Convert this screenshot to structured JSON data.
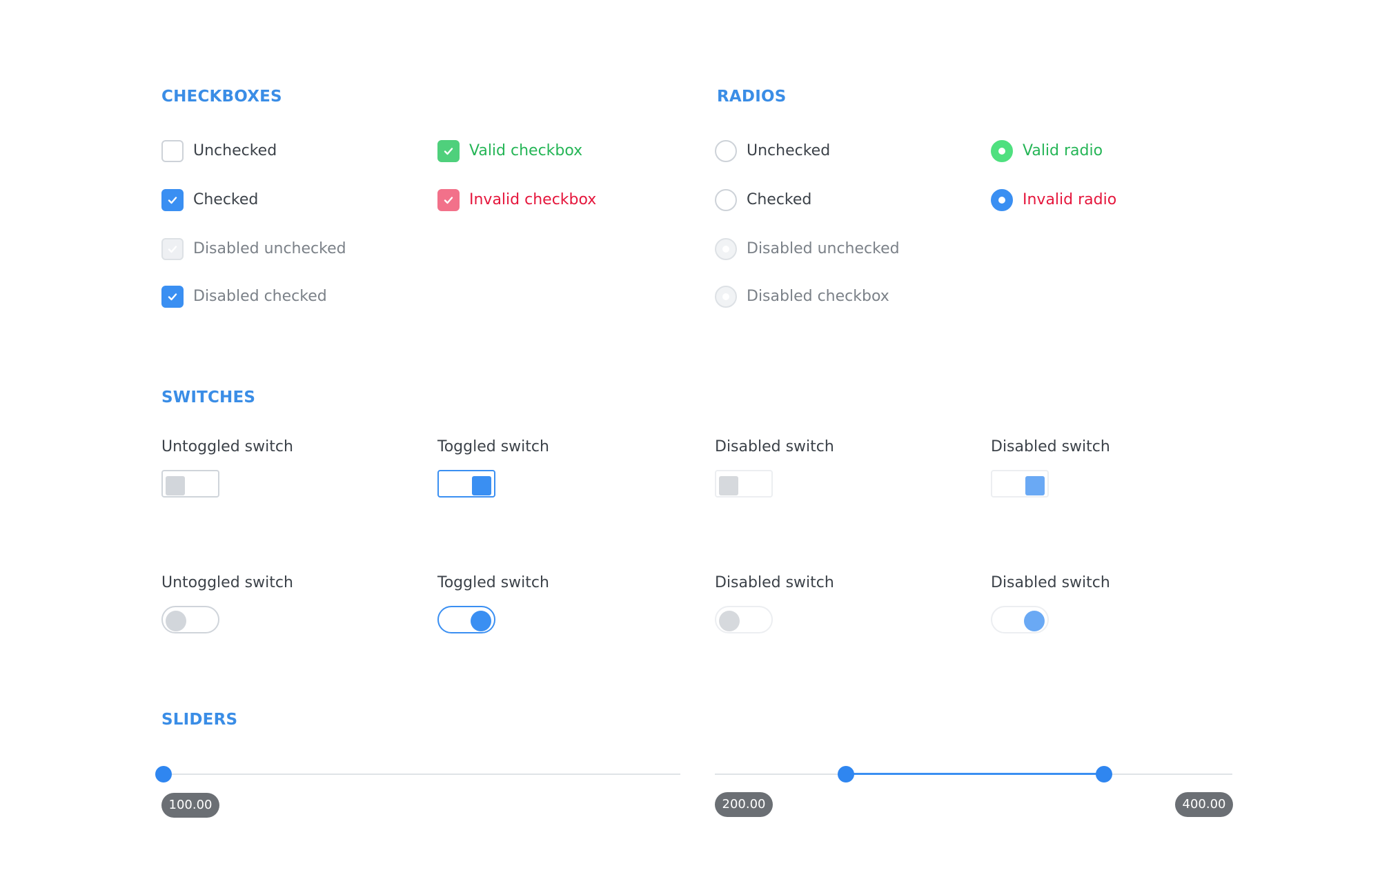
{
  "sections": {
    "checkboxes": "CHECKBOXES",
    "radios": "RADIOS",
    "switches": "SWITCHES",
    "sliders": "SLIDERS"
  },
  "checkboxes": {
    "unchecked": "Unchecked",
    "checked": "Checked",
    "disabled_unchecked": "Disabled unchecked",
    "disabled_checked": "Disabled checked",
    "valid": "Valid checkbox",
    "invalid": "Invalid checkbox"
  },
  "radios": {
    "unchecked": "Unchecked",
    "checked": "Checked",
    "disabled_unchecked": "Disabled unchecked",
    "disabled_checkbox": "Disabled checkbox",
    "valid": "Valid radio",
    "invalid": "Invalid radio"
  },
  "switches": {
    "row1": [
      "Untoggled switch",
      "Toggled switch",
      "Disabled switch",
      "Disabled switch"
    ],
    "row2": [
      "Untoggled switch",
      "Toggled switch",
      "Disabled switch",
      "Disabled switch"
    ]
  },
  "sliders": {
    "single_value": "100.00",
    "range_low": "200.00",
    "range_high": "400.00"
  },
  "colors": {
    "accent": "#3a8ff2",
    "valid": "#25b556",
    "invalid": "#e5163c",
    "tooltip": "#6b6f74"
  }
}
